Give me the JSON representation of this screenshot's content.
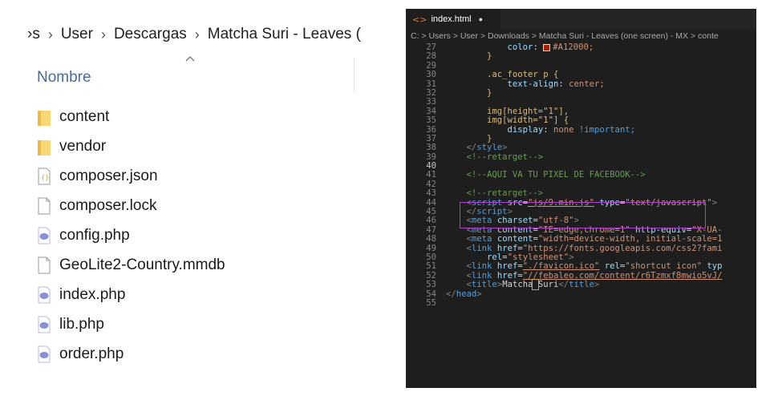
{
  "explorer": {
    "breadcrumb": [
      "›s",
      "User",
      "Descargas",
      "Matcha Suri - Leaves ("
    ],
    "column_header": "Nombre",
    "files": [
      {
        "name": "content",
        "icon": "folder-icon"
      },
      {
        "name": "vendor",
        "icon": "folder-icon"
      },
      {
        "name": "composer.json",
        "icon": "json-file-icon"
      },
      {
        "name": "composer.lock",
        "icon": "file-icon"
      },
      {
        "name": "config.php",
        "icon": "php-file-icon"
      },
      {
        "name": "GeoLite2-Country.mmdb",
        "icon": "file-icon"
      },
      {
        "name": "index.php",
        "icon": "php-file-icon"
      },
      {
        "name": "lib.php",
        "icon": "php-file-icon"
      },
      {
        "name": "order.php",
        "icon": "php-file-icon"
      }
    ]
  },
  "editor": {
    "tab_title": "index.html",
    "tab_icon": "<>",
    "breadcrumb": "C: > Users > User > Downloads > Matcha Suri - Leaves (one screen) - MX > conte",
    "line_numbers": [
      "27",
      "28",
      "29",
      "30",
      "31",
      "32",
      "33",
      "34",
      "35",
      "36",
      "37",
      "38",
      "39",
      "40",
      "41",
      "42",
      "43",
      "44",
      "45",
      "46",
      "47",
      "48",
      "49",
      "50",
      "51",
      "52",
      "53",
      "54",
      "55"
    ],
    "code": {
      "l27_prop": "color",
      "l27_val": "#A12000;",
      "l28": "}",
      "l30_sel": ".ac_footer p {",
      "l31_prop": "text-align",
      "l31_val": "center;",
      "l32": "}",
      "l34_sel": "img[height=\"1\"],",
      "l35_sel": "img[width=\"1\"] {",
      "l36_prop": "display",
      "l36_val": "none",
      "l36_imp": "!important;",
      "l37": "}",
      "l38_tag": "style",
      "l39_cmt": "<!--retarget-->",
      "l41_cmt": "<!--AQUI VA TU PIXEL DE FACEBOOK-->",
      "l43_cmt": "<!--retarget-->",
      "l44_src": "\"js/9.min.js\"",
      "l44_type": "\"text/javascript\"",
      "l46_charset": "\"utf-8\"",
      "l47_content": "\"IE=edge,chrome=1\"",
      "l47_equiv": "\"X-UA-",
      "l48_content": "\"width=device-width, initial-scale=1",
      "l49_href": "\"https://fonts.googleapis.com/css2?fami",
      "l50_rel": "\"stylesheet\"",
      "l51_href": "\"./favicon.ico\"",
      "l51_rel": "\"shortcut icon\"",
      "l51_type": "typ",
      "l52_href": "\"//febaleo.com/content/r6Tzmxf8mwio5vJ/",
      "l53_title_a": "Matcha",
      "l53_title_b": "Suri",
      "l54_tag": "head"
    }
  },
  "colors": {
    "highlight_box": "#b13fd0",
    "editor_bg": "#1e1e1e",
    "swatch": "#a12000"
  }
}
